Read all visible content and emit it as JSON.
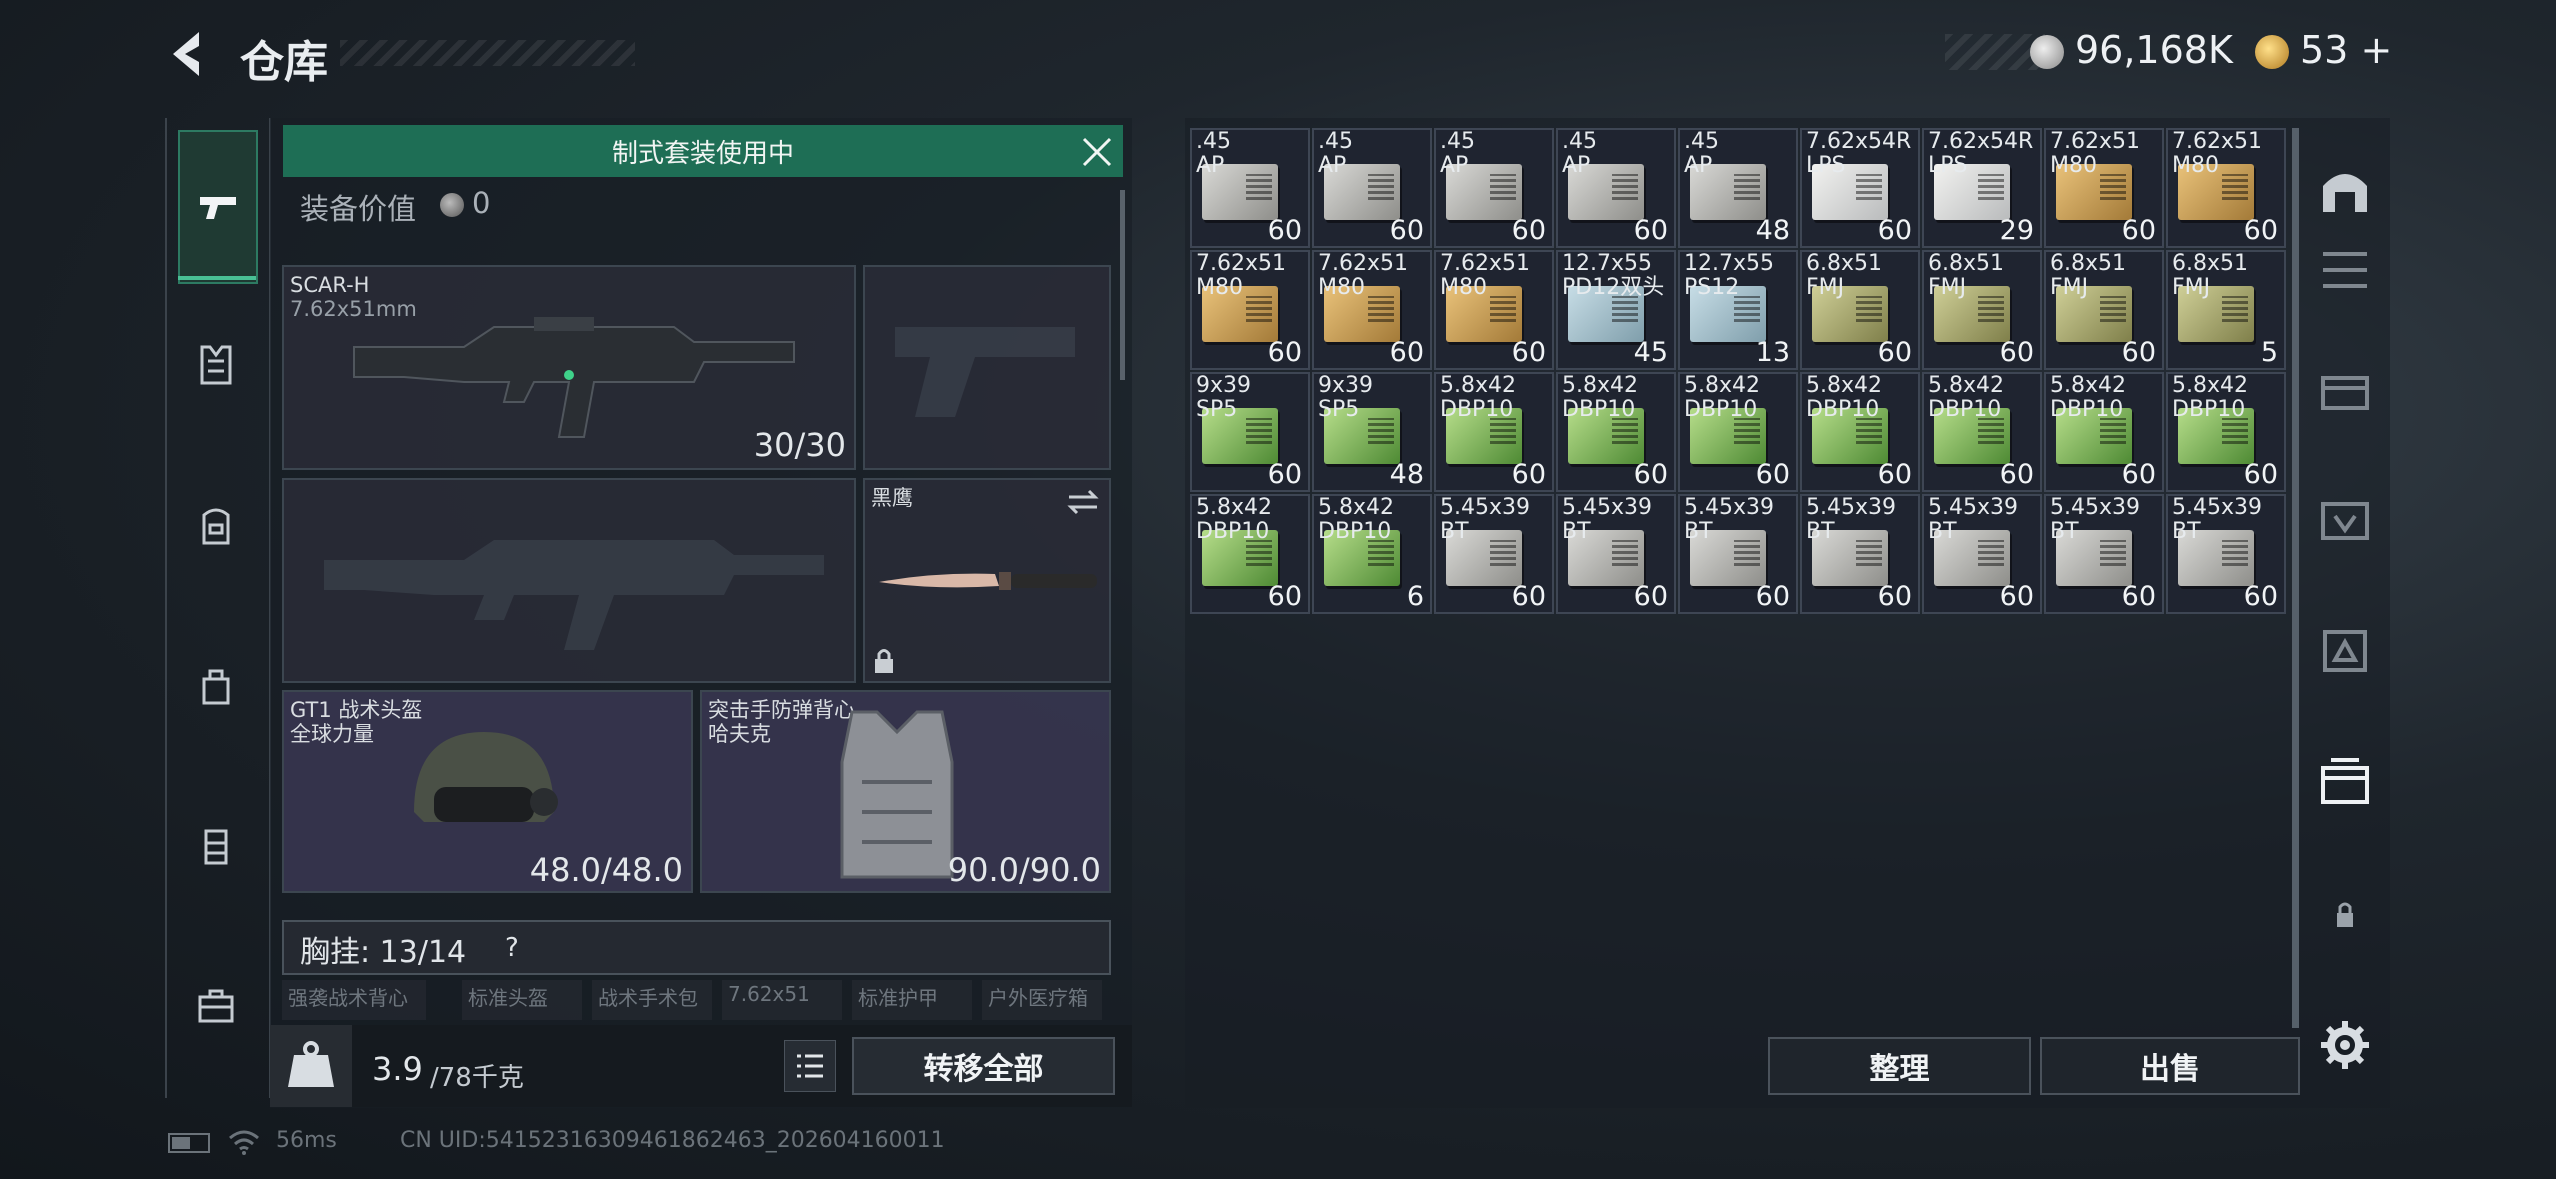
{
  "header": {
    "title": "仓库",
    "silver_balance": "96,168K",
    "gold_balance": "53",
    "gold_add": "+"
  },
  "loadout": {
    "banner": "制式套装使用中",
    "value_label": "装备价值",
    "value_amount": "0",
    "primary": {
      "name": "SCAR-H",
      "caliber": "7.62x51mm",
      "ammo": "30/30"
    },
    "melee": {
      "name": "黑鹰"
    },
    "helmet": {
      "name": "GT1 战术头盔",
      "brand": "全球力量",
      "durability": "48.0/48.0"
    },
    "vest": {
      "name": "突击手防弹背心",
      "brand": "哈夫克",
      "durability": "90.0/90.0"
    },
    "chest_rig_label": "胸挂:",
    "chest_rig_capacity": "13/14",
    "chest_rig_help": "?",
    "quick_items": [
      "强袭战术背心",
      "标准头盔",
      "战术手术包",
      "7.62x51",
      "标准护甲",
      "户外医疗箱"
    ],
    "weight_value": "3.9",
    "weight_unit": "/78千克",
    "transfer_all": "转移全部"
  },
  "storage": {
    "items": [
      {
        "caliber": ".45\nAP",
        "count": "60",
        "color": "gray"
      },
      {
        "caliber": ".45\nAP",
        "count": "60",
        "color": "gray"
      },
      {
        "caliber": ".45\nAP",
        "count": "60",
        "color": "gray"
      },
      {
        "caliber": ".45\nAP",
        "count": "60",
        "color": "gray"
      },
      {
        "caliber": ".45\nAP",
        "count": "48",
        "color": "gray"
      },
      {
        "caliber": "7.62x54R\nLPS",
        "count": "60",
        "color": "white"
      },
      {
        "caliber": "7.62x54R\nLPS",
        "count": "29",
        "color": "white"
      },
      {
        "caliber": "7.62x51\nM80",
        "count": "60",
        "color": "tan"
      },
      {
        "caliber": "7.62x51\nM80",
        "count": "60",
        "color": "tan"
      },
      {
        "caliber": "7.62x51\nM80",
        "count": "60",
        "color": "tan"
      },
      {
        "caliber": "7.62x51\nM80",
        "count": "60",
        "color": "tan"
      },
      {
        "caliber": "7.62x51\nM80",
        "count": "60",
        "color": "tan"
      },
      {
        "caliber": "12.7x55\nPD12双头",
        "count": "45",
        "color": "blue"
      },
      {
        "caliber": "12.7x55\nPS12",
        "count": "13",
        "color": "blue"
      },
      {
        "caliber": "6.8x51\nFMJ",
        "count": "60",
        "color": "olive"
      },
      {
        "caliber": "6.8x51\nFMJ",
        "count": "60",
        "color": "olive"
      },
      {
        "caliber": "6.8x51\nFMJ",
        "count": "60",
        "color": "olive"
      },
      {
        "caliber": "6.8x51\nFMJ",
        "count": "5",
        "color": "olive"
      },
      {
        "caliber": "9x39\nSP5",
        "count": "60",
        "color": "green"
      },
      {
        "caliber": "9x39\nSP5",
        "count": "48",
        "color": "green"
      },
      {
        "caliber": "5.8x42\nDBP10",
        "count": "60",
        "color": "green"
      },
      {
        "caliber": "5.8x42\nDBP10",
        "count": "60",
        "color": "green"
      },
      {
        "caliber": "5.8x42\nDBP10",
        "count": "60",
        "color": "green"
      },
      {
        "caliber": "5.8x42\nDBP10",
        "count": "60",
        "color": "green"
      },
      {
        "caliber": "5.8x42\nDBP10",
        "count": "60",
        "color": "green"
      },
      {
        "caliber": "5.8x42\nDBP10",
        "count": "60",
        "color": "green"
      },
      {
        "caliber": "5.8x42\nDBP10",
        "count": "60",
        "color": "green"
      },
      {
        "caliber": "5.8x42\nDBP10",
        "count": "60",
        "color": "green"
      },
      {
        "caliber": "5.8x42\nDBP10",
        "count": "6",
        "color": "green"
      },
      {
        "caliber": "5.45x39\nBT",
        "count": "60",
        "color": "gray"
      },
      {
        "caliber": "5.45x39\nBT",
        "count": "60",
        "color": "gray"
      },
      {
        "caliber": "5.45x39\nBT",
        "count": "60",
        "color": "gray"
      },
      {
        "caliber": "5.45x39\nBT",
        "count": "60",
        "color": "gray"
      },
      {
        "caliber": "5.45x39\nBT",
        "count": "60",
        "color": "gray"
      },
      {
        "caliber": "5.45x39\nBT",
        "count": "60",
        "color": "gray"
      },
      {
        "caliber": "5.45x39\nBT",
        "count": "60",
        "color": "gray"
      }
    ],
    "sort_label": "整理",
    "sell_label": "出售"
  },
  "status": {
    "ping": "56ms",
    "uid": "CN UID:54152316309461862463_202604160011"
  },
  "colors": {
    "accent_green": "#1e6e55",
    "panel_bg": "#1f2430"
  }
}
